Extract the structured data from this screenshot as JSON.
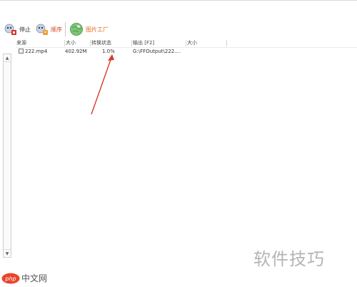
{
  "toolbar": {
    "stop_label": "停止",
    "sort_label": "顺序",
    "factory_label": "图片工厂",
    "colors": {
      "sort_label": "#d44a2a",
      "factory_label": "#e06a1a"
    }
  },
  "list": {
    "columns": [
      "来源",
      "大小",
      "转换状态",
      "输出 [F2]",
      "大小"
    ],
    "rows": [
      {
        "source": "222.mp4",
        "size": "402.92M",
        "status": "1.0%",
        "output": "G:\\FFOutput\\222....",
        "out_size": ""
      }
    ]
  },
  "annotation": {
    "type": "red-arrow",
    "color": "#d63b2a"
  },
  "watermark": {
    "right_text": "软件技巧",
    "logo_text": "中文网",
    "logo_mark": "php"
  }
}
